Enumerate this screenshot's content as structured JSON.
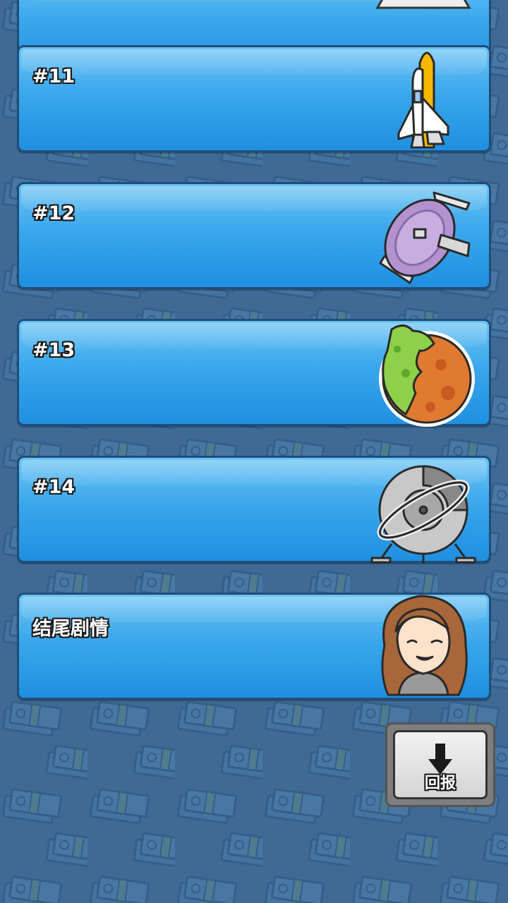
{
  "colors": {
    "background": "#3f6a96",
    "card_top": "#6cc4f4",
    "card_bottom": "#1f8fe0",
    "card_border": "#1f4d7a"
  },
  "cards": [
    {
      "label": "#11",
      "icon": "space-shuttle-icon"
    },
    {
      "label": "#12",
      "icon": "satellite-dish-icon"
    },
    {
      "label": "#13",
      "icon": "terraformed-planet-icon"
    },
    {
      "label": "#14",
      "icon": "radio-telescope-icon"
    },
    {
      "label": "结尾剧情",
      "icon": "woman-portrait-icon"
    }
  ],
  "return_button": {
    "label": "回报",
    "icon": "down-arrow-icon"
  }
}
